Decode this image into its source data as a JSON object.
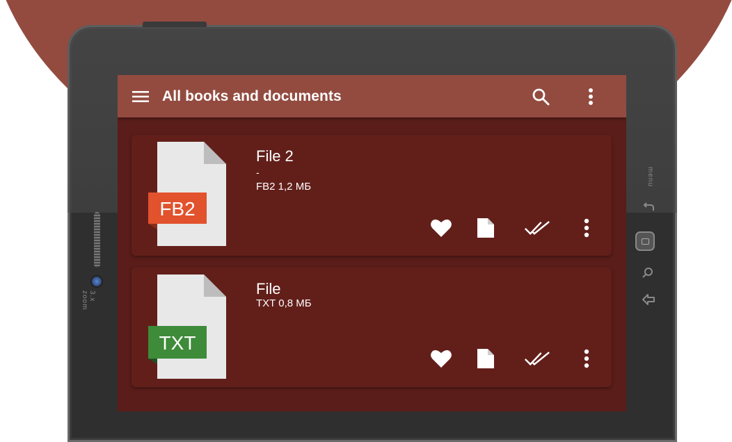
{
  "colors": {
    "accent": "#934b40",
    "screen_bg": "#5a1d19",
    "card_bg": "#621f1a",
    "fb2_badge": "#e1522d",
    "txt_badge": "#3e8b3a",
    "device": "#2f2f2f"
  },
  "device": {
    "brand_left": "3.x zoom",
    "brand_right": "menu"
  },
  "appbar": {
    "menu_icon": "hamburger-menu-icon",
    "title": "All books and documents",
    "search_icon": "search-icon",
    "overflow_icon": "more-vert-icon"
  },
  "files": [
    {
      "name": "File 2",
      "author": "-",
      "meta": "FB2 1,2 МБ",
      "badge": "FB2",
      "actions": [
        "favorite-icon",
        "document-icon",
        "done-all-icon",
        "more-vert-icon"
      ]
    },
    {
      "name": "File",
      "author": "",
      "meta": "TXT 0,8 МБ",
      "badge": "TXT",
      "actions": [
        "favorite-icon",
        "document-icon",
        "done-all-icon",
        "more-vert-icon"
      ]
    }
  ]
}
